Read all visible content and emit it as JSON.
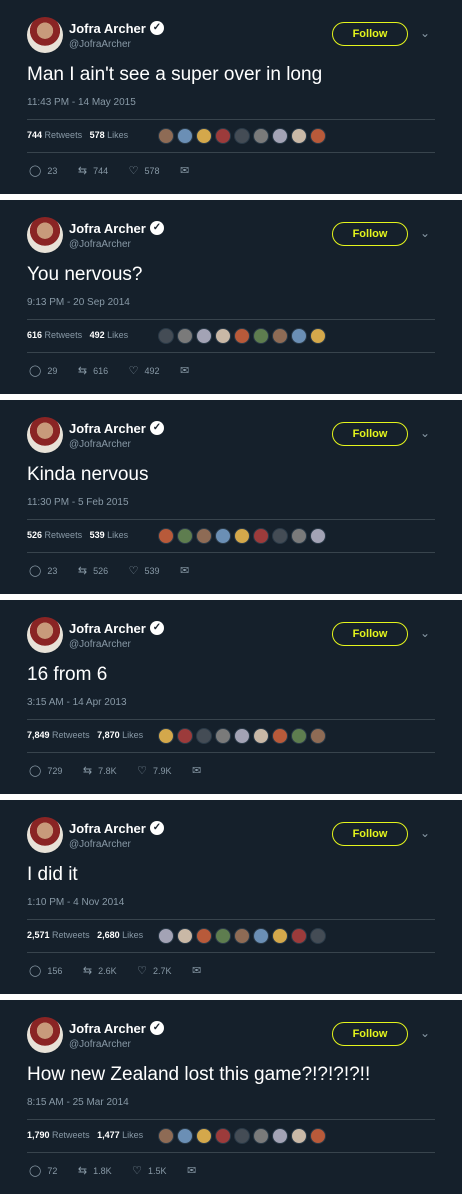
{
  "user": {
    "name": "Jofra Archer",
    "handle": "@JofraArcher",
    "verified_glyph": "✓"
  },
  "labels": {
    "follow": "Follow",
    "retweets": "Retweets",
    "likes": "Likes"
  },
  "icons": {
    "reply": "reply-icon",
    "retweet": "retweet-icon",
    "like": "heart-icon",
    "dm": "envelope-icon",
    "menu": "chevron-down-icon"
  },
  "tweets": [
    {
      "text": "Man I ain't see a super over in long",
      "time": "11:43 PM - 14 May 2015",
      "retweets": "744",
      "likes": "578",
      "replies_count": "23",
      "retweets_count": "744",
      "likes_count": "578"
    },
    {
      "text": "You nervous?",
      "time": "9:13 PM - 20 Sep 2014",
      "retweets": "616",
      "likes": "492",
      "replies_count": "29",
      "retweets_count": "616",
      "likes_count": "492"
    },
    {
      "text": "Kinda nervous",
      "time": "11:30 PM - 5 Feb 2015",
      "retweets": "526",
      "likes": "539",
      "replies_count": "23",
      "retweets_count": "526",
      "likes_count": "539"
    },
    {
      "text": "16 from 6",
      "time": "3:15 AM - 14 Apr 2013",
      "retweets": "7,849",
      "likes": "7,870",
      "replies_count": "729",
      "retweets_count": "7.8K",
      "likes_count": "7.9K"
    },
    {
      "text": "I did it",
      "time": "1:10 PM - 4 Nov 2014",
      "retweets": "2,571",
      "likes": "2,680",
      "replies_count": "156",
      "retweets_count": "2.6K",
      "likes_count": "2.7K"
    },
    {
      "text": "How new Zealand lost this game?!?!?!?!!",
      "time": "8:15 AM - 25 Mar 2014",
      "retweets": "1,790",
      "likes": "1,477",
      "replies_count": "72",
      "retweets_count": "1.8K",
      "likes_count": "1.5K"
    }
  ],
  "colors": {
    "background": "#15202b",
    "follow_accent": "#e4f51c",
    "muted": "#8899a6",
    "divider": "#38444d"
  }
}
